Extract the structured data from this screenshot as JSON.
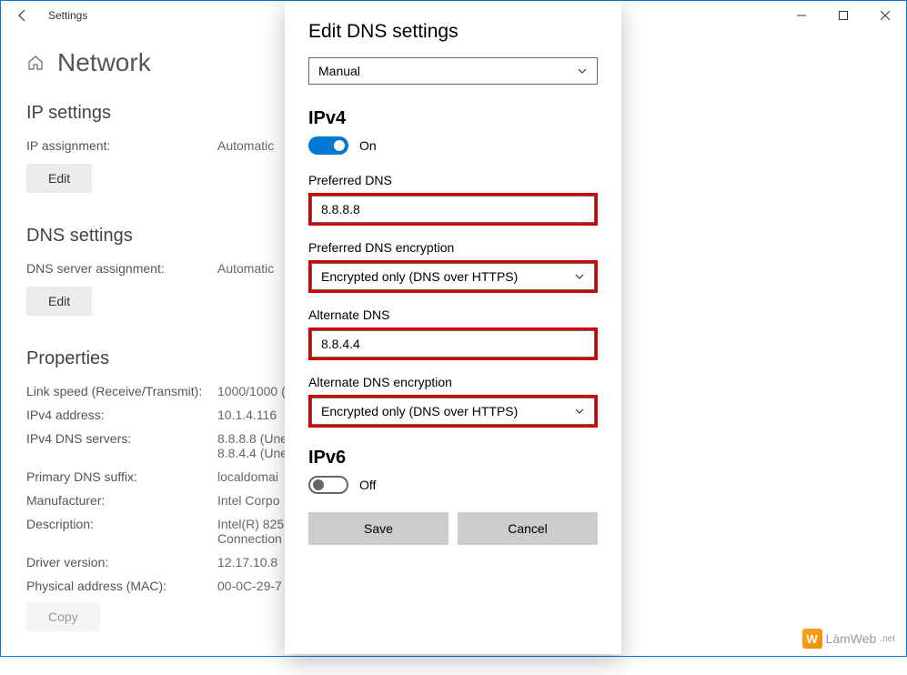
{
  "titlebar": {
    "title": "Settings"
  },
  "page": {
    "title": "Network"
  },
  "ip_settings": {
    "heading": "IP settings",
    "assignment_label": "IP assignment:",
    "assignment_value": "Automatic",
    "edit_label": "Edit"
  },
  "dns_settings": {
    "heading": "DNS settings",
    "assignment_label": "DNS server assignment:",
    "assignment_value": "Automatic",
    "edit_label": "Edit"
  },
  "properties": {
    "heading": "Properties",
    "rows": [
      {
        "label": "Link speed (Receive/Transmit):",
        "value": "1000/1000 ("
      },
      {
        "label": "IPv4 address:",
        "value": "10.1.4.116"
      },
      {
        "label": "IPv4 DNS servers:",
        "value": "8.8.8.8 (Une\n8.8.4.4 (Une"
      },
      {
        "label": "Primary DNS suffix:",
        "value": "localdomai"
      },
      {
        "label": "Manufacturer:",
        "value": "Intel Corpo"
      },
      {
        "label": "Description:",
        "value": "Intel(R) 825\nConnection"
      },
      {
        "label": "Driver version:",
        "value": "12.17.10.8"
      },
      {
        "label": "Physical address (MAC):",
        "value": "00-0C-29-7"
      }
    ],
    "copy_label": "Copy"
  },
  "modal": {
    "title": "Edit DNS settings",
    "mode": "Manual",
    "ipv4": {
      "heading": "IPv4",
      "toggle_state": "On",
      "preferred_label": "Preferred DNS",
      "preferred_value": "8.8.8.8",
      "preferred_enc_label": "Preferred DNS encryption",
      "preferred_enc_value": "Encrypted only (DNS over HTTPS)",
      "alternate_label": "Alternate DNS",
      "alternate_value": "8.8.4.4",
      "alternate_enc_label": "Alternate DNS encryption",
      "alternate_enc_value": "Encrypted only (DNS over HTTPS)"
    },
    "ipv6": {
      "heading": "IPv6",
      "toggle_state": "Off"
    },
    "save_label": "Save",
    "cancel_label": "Cancel"
  },
  "watermark": {
    "text": "LàmWeb",
    "suffix": ".net"
  }
}
